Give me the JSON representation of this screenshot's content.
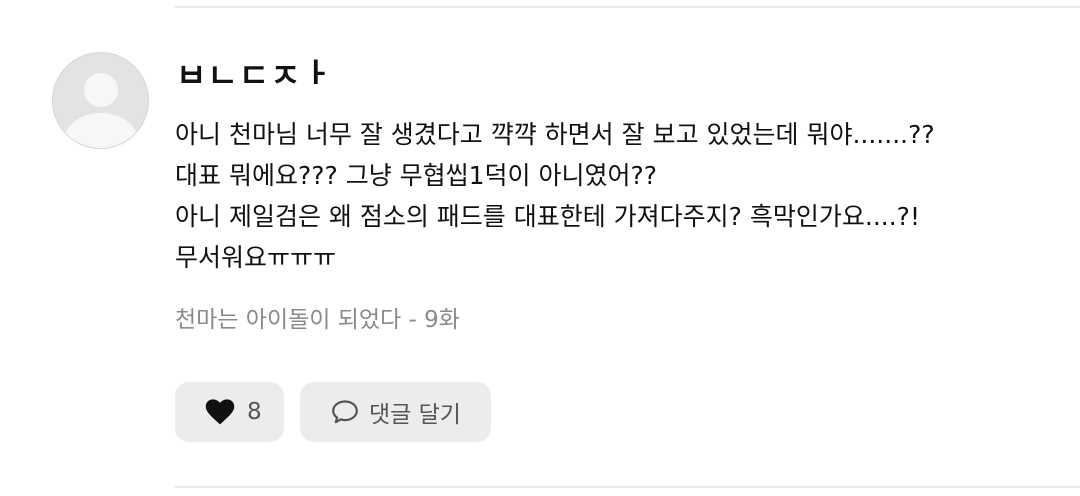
{
  "comment": {
    "author": "ㅂㄴㄷㅈㅏ",
    "lines": [
      "아니 천마님 너무 잘 생겼다고 꺅꺅 하면서 잘 보고 있었는데 뭐야.......??",
      "대표 뭐에요??? 그냥 무협씹1덕이 아니였어??",
      "아니 제일검은 왜 점소의 패드를 대표한테 가져다주지? 흑막인가요....?!",
      "무서워요ㅠㅠㅠ"
    ],
    "episode": "천마는 아이돌이 되었다 - 9화"
  },
  "actions": {
    "like_icon": "heart-icon",
    "like_count": "8",
    "reply_icon": "speech-bubble-icon",
    "reply_label": "댓글 달기"
  },
  "colors": {
    "button_bg": "#ececec",
    "muted_text": "#8a8a8a",
    "divider": "#e8e8e8"
  }
}
